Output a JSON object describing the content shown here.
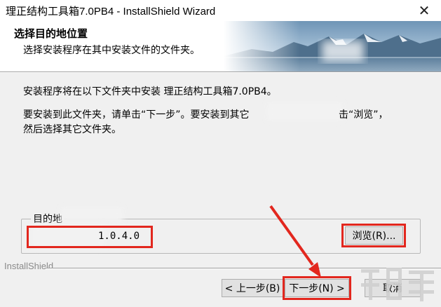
{
  "window": {
    "title": "理正结构工具箱7.0PB4 - InstallShield Wizard",
    "close_glyph": "✕"
  },
  "header": {
    "title": "选择目的地位置",
    "subtitle": "选择安装程序在其中安装文件的文件夹。"
  },
  "body": {
    "line1": "安装程序将在以下文件夹中安装 理正结构工具箱7.0PB4。",
    "line2a": "要安装到此文件夹，请单击“下一步”。要安装到其它",
    "line2b": "击“浏览”，",
    "line3": "然后选择其它文件夹。"
  },
  "destination": {
    "group_label": "目的地",
    "path_visible": "1.0.4.0",
    "browse_label": "浏览(R)..."
  },
  "footer": {
    "brand": "InstallShield",
    "back_label": "< 上一步(B)",
    "next_label": "下一步(N) >",
    "cancel_label": "取消"
  },
  "colors": {
    "highlight": "#e2271e",
    "window_bg": "#f0f0f0"
  }
}
